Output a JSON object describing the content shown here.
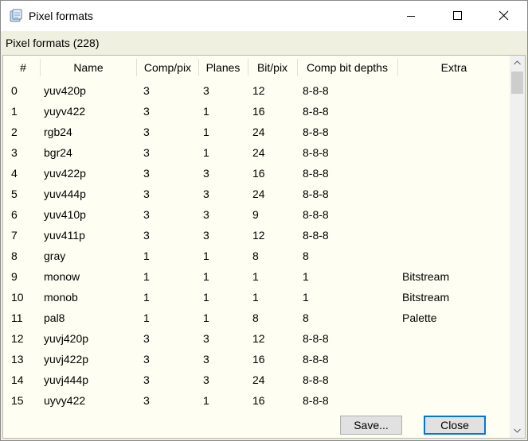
{
  "window": {
    "title": "Pixel formats"
  },
  "group_label": "Pixel formats (228)",
  "columns": [
    "#",
    "Name",
    "Comp/pix",
    "Planes",
    "Bit/pix",
    "Comp bit depths",
    "Extra"
  ],
  "rows": [
    [
      "0",
      "yuv420p",
      "3",
      "3",
      "12",
      "8-8-8",
      ""
    ],
    [
      "1",
      "yuyv422",
      "3",
      "1",
      "16",
      "8-8-8",
      ""
    ],
    [
      "2",
      "rgb24",
      "3",
      "1",
      "24",
      "8-8-8",
      ""
    ],
    [
      "3",
      "bgr24",
      "3",
      "1",
      "24",
      "8-8-8",
      ""
    ],
    [
      "4",
      "yuv422p",
      "3",
      "3",
      "16",
      "8-8-8",
      ""
    ],
    [
      "5",
      "yuv444p",
      "3",
      "3",
      "24",
      "8-8-8",
      ""
    ],
    [
      "6",
      "yuv410p",
      "3",
      "3",
      "9",
      "8-8-8",
      ""
    ],
    [
      "7",
      "yuv411p",
      "3",
      "3",
      "12",
      "8-8-8",
      ""
    ],
    [
      "8",
      "gray",
      "1",
      "1",
      "8",
      "8",
      ""
    ],
    [
      "9",
      "monow",
      "1",
      "1",
      "1",
      "1",
      "Bitstream"
    ],
    [
      "10",
      "monob",
      "1",
      "1",
      "1",
      "1",
      "Bitstream"
    ],
    [
      "11",
      "pal8",
      "1",
      "1",
      "8",
      "8",
      "Palette"
    ],
    [
      "12",
      "yuvj420p",
      "3",
      "3",
      "12",
      "8-8-8",
      ""
    ],
    [
      "13",
      "yuvj422p",
      "3",
      "3",
      "16",
      "8-8-8",
      ""
    ],
    [
      "14",
      "yuvj444p",
      "3",
      "3",
      "24",
      "8-8-8",
      ""
    ],
    [
      "15",
      "uyvy422",
      "3",
      "1",
      "16",
      "8-8-8",
      ""
    ]
  ],
  "buttons": {
    "save": "Save...",
    "close": "Close"
  },
  "colors": {
    "client_bg": "#f0f0e0",
    "list_bg": "#fefef2",
    "focus_border": "#0078d7"
  },
  "icons": [
    "app-icon",
    "minimize-icon",
    "maximize-icon",
    "close-icon",
    "scroll-up-arrow-icon",
    "scroll-down-arrow-icon"
  ]
}
